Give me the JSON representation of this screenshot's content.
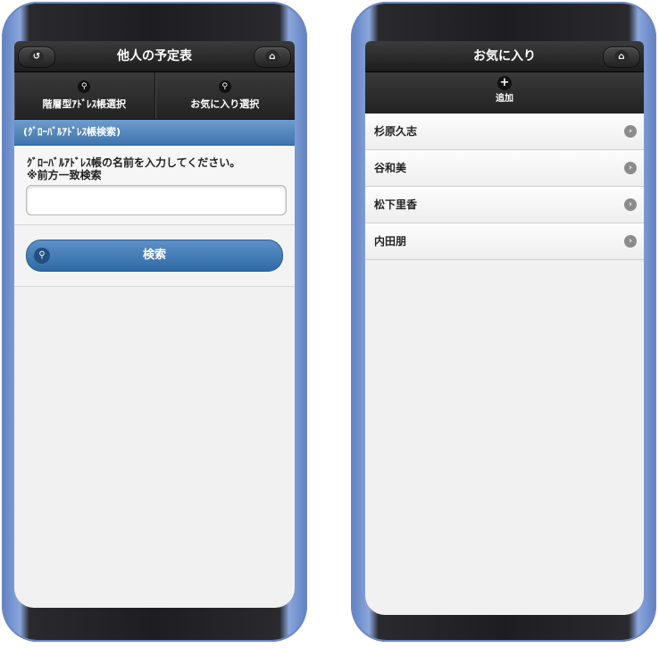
{
  "left": {
    "header": {
      "title": "他人の予定表",
      "back_icon": "back-icon",
      "home_icon": "home-icon"
    },
    "nav": [
      {
        "label": "階層型ｱﾄﾞﾚｽ帳選択",
        "icon": "search-icon"
      },
      {
        "label": "お気に入り選択",
        "icon": "search-icon"
      }
    ],
    "section_title": "(ｸﾞﾛｰﾊﾞﾙｱﾄﾞﾚｽ帳検索)",
    "form": {
      "label_line1": "ｸﾞﾛｰﾊﾞﾙｱﾄﾞﾚｽ帳の名前を入力してください。",
      "label_line2": "※前方一致検索",
      "input_value": ""
    },
    "search_button": "検索"
  },
  "right": {
    "header": {
      "title": "お気に入り",
      "home_icon": "home-icon"
    },
    "add_label": "追加",
    "favorites": [
      "杉原久志",
      "谷和美",
      "松下里香",
      "内田朋"
    ]
  },
  "colors": {
    "accent": "#3f75ad",
    "header_dark": "#222222",
    "phone_frame": "#6c86c4"
  }
}
